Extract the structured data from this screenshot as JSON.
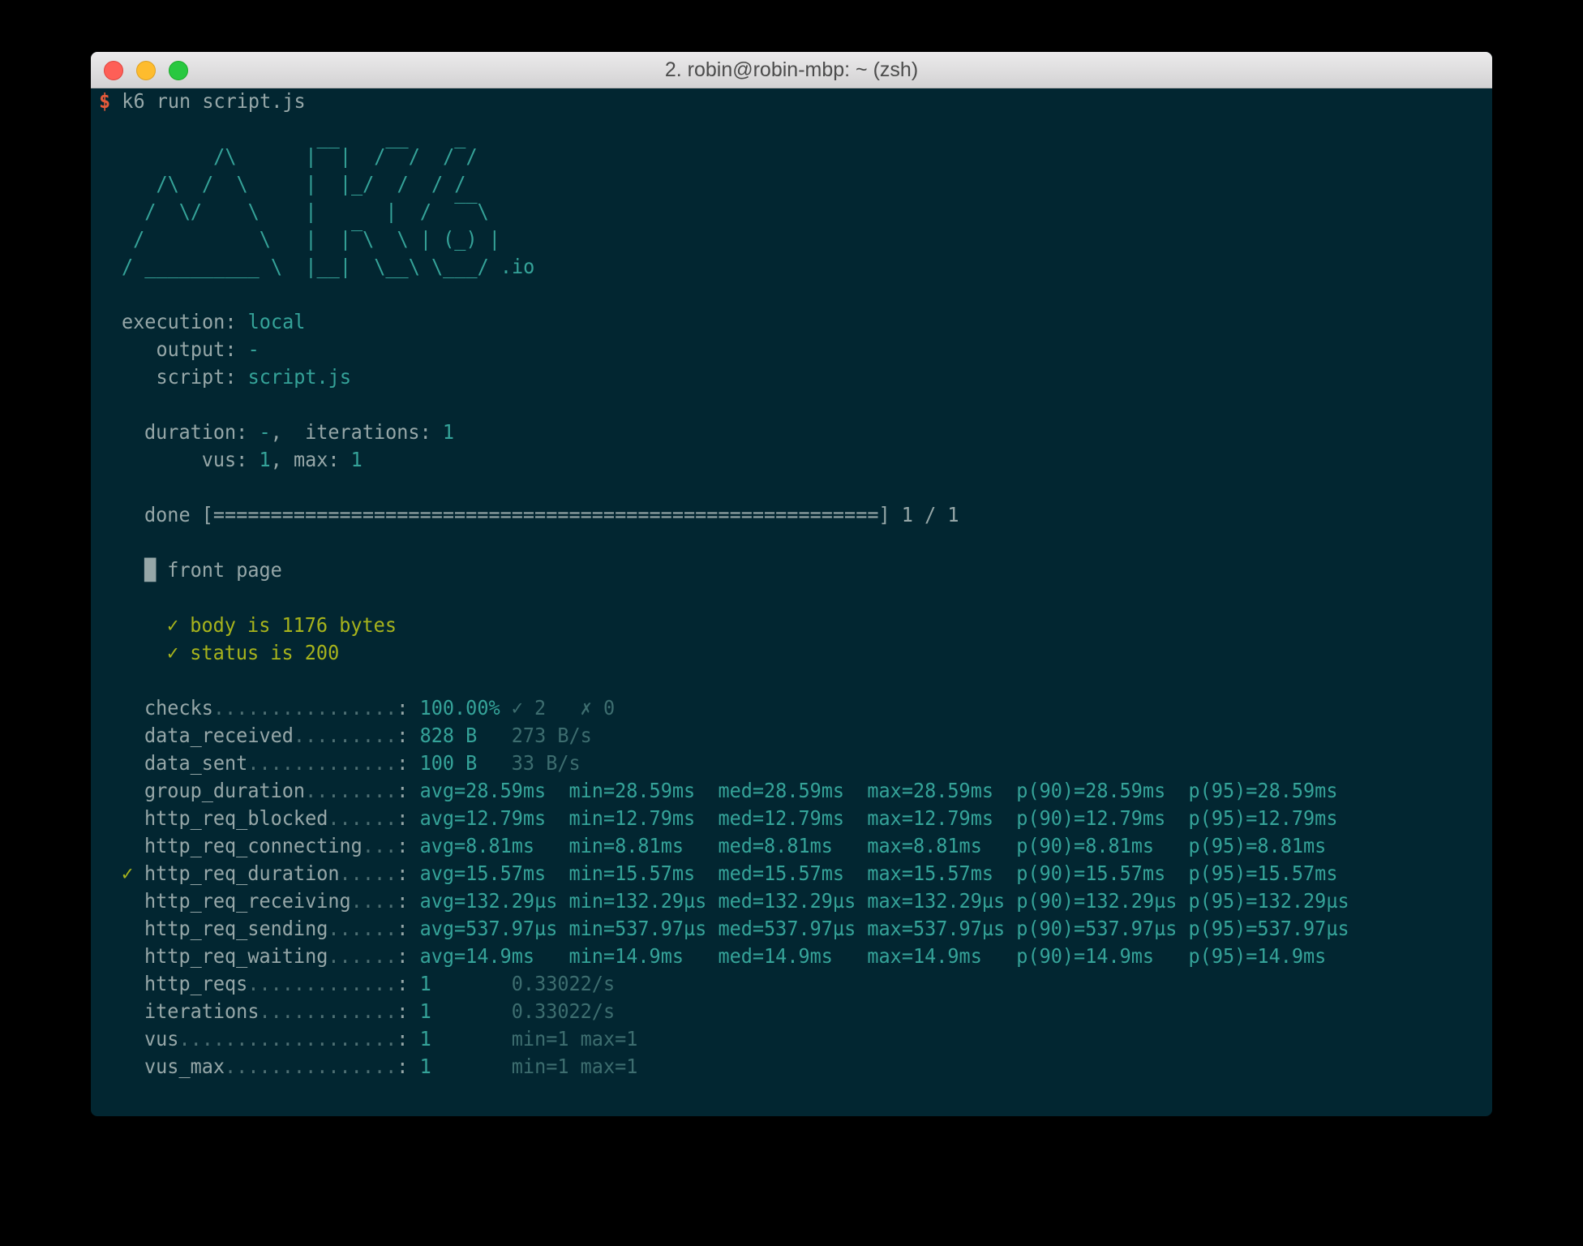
{
  "window": {
    "title": "2. robin@robin-mbp: ~ (zsh)"
  },
  "prompt": {
    "symbol": "$",
    "command": " k6 run script.js"
  },
  "logo": [
    "        /\\      |‾‾|  /‾‾/  /‾/",
    "   /\\  /  \\     |  |_/  /  / /",
    "  /  \\/    \\    |      |  /  ‾‾\\",
    " /          \\   |  |‾\\  \\ | (_) |",
    "/ __________ \\  |__|  \\__\\ \\___/ .io"
  ],
  "config": {
    "execution_key": "execution: ",
    "execution_val": "local",
    "output_key": "   output: ",
    "output_val": "-",
    "script_key": "   script: ",
    "script_val": "script.js",
    "duration_key": "duration: ",
    "duration_val": "-",
    "duration_sep": ",  iterations: ",
    "iterations_val": "1",
    "vus_key": "     vus: ",
    "vus_val": "1",
    "max_sep": ", max: ",
    "max_val": "1"
  },
  "progress": {
    "label": "done ",
    "bar": "[==========================================================]",
    "count": " 1 / 1"
  },
  "group": {
    "icon": "█",
    "name": " front page"
  },
  "checks": [
    {
      "mark": "✓",
      "text": " body is 1176 bytes"
    },
    {
      "mark": "✓",
      "text": " status is 200"
    }
  ],
  "threshold_mark": "✓",
  "metrics": [
    {
      "name": "checks",
      "dots": "................",
      "colon": ": ",
      "v1": "100.00%",
      "extra": " ✓ 2   ✗ 0"
    },
    {
      "name": "data_received",
      "dots": ".........",
      "colon": ": ",
      "v1": "828 B",
      "extra": "   273 B/s"
    },
    {
      "name": "data_sent",
      "dots": ".............",
      "colon": ": ",
      "v1": "100 B",
      "extra": "   33 B/s"
    },
    {
      "name": "group_duration",
      "dots": "........",
      "colon": ": ",
      "stats": [
        "avg=28.59ms  ",
        "min=28.59ms  ",
        "med=28.59ms  ",
        "max=28.59ms  ",
        "p(90)=28.59ms  ",
        "p(95)=28.59ms"
      ]
    },
    {
      "name": "http_req_blocked",
      "dots": "......",
      "colon": ": ",
      "stats": [
        "avg=12.79ms  ",
        "min=12.79ms  ",
        "med=12.79ms  ",
        "max=12.79ms  ",
        "p(90)=12.79ms  ",
        "p(95)=12.79ms"
      ]
    },
    {
      "name": "http_req_connecting",
      "dots": "...",
      "colon": ": ",
      "stats": [
        "avg=8.81ms   ",
        "min=8.81ms   ",
        "med=8.81ms   ",
        "max=8.81ms   ",
        "p(90)=8.81ms   ",
        "p(95)=8.81ms"
      ]
    },
    {
      "name": "http_req_duration",
      "dots": ".....",
      "colon": ": ",
      "stats": [
        "avg=15.57ms  ",
        "min=15.57ms  ",
        "med=15.57ms  ",
        "max=15.57ms  ",
        "p(90)=15.57ms  ",
        "p(95)=15.57ms"
      ]
    },
    {
      "name": "http_req_receiving",
      "dots": "....",
      "colon": ": ",
      "stats": [
        "avg=132.29µs ",
        "min=132.29µs ",
        "med=132.29µs ",
        "max=132.29µs ",
        "p(90)=132.29µs ",
        "p(95)=132.29µs"
      ]
    },
    {
      "name": "http_req_sending",
      "dots": "......",
      "colon": ": ",
      "stats": [
        "avg=537.97µs ",
        "min=537.97µs ",
        "med=537.97µs ",
        "max=537.97µs ",
        "p(90)=537.97µs ",
        "p(95)=537.97µs"
      ]
    },
    {
      "name": "http_req_waiting",
      "dots": "......",
      "colon": ": ",
      "stats": [
        "avg=14.9ms   ",
        "min=14.9ms   ",
        "med=14.9ms   ",
        "max=14.9ms   ",
        "p(90)=14.9ms   ",
        "p(95)=14.9ms"
      ]
    },
    {
      "name": "http_reqs",
      "dots": ".............",
      "colon": ": ",
      "v1": "1",
      "extra": "       0.33022/s"
    },
    {
      "name": "iterations",
      "dots": "............",
      "colon": ": ",
      "v1": "1",
      "extra": "       0.33022/s"
    },
    {
      "name": "vus",
      "dots": "...................",
      "colon": ": ",
      "v1": "1",
      "extra": "       min=1 max=1"
    },
    {
      "name": "vus_max",
      "dots": "...............",
      "colon": ": ",
      "v1": "1",
      "extra": "       min=1 max=1"
    }
  ]
}
